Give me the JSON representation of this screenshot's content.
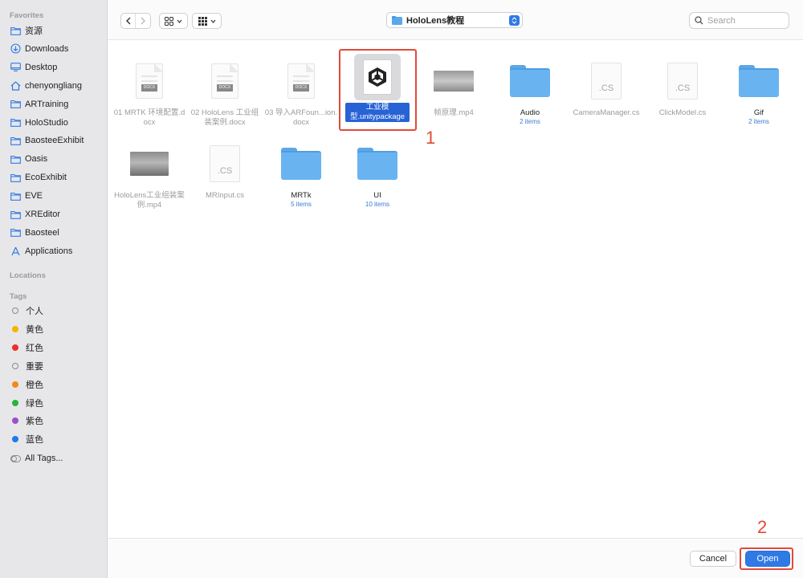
{
  "sidebar": {
    "favorites_label": "Favorites",
    "favorites": [
      {
        "label": "资源",
        "icon": "folder-icon"
      },
      {
        "label": "Downloads",
        "icon": "download-icon"
      },
      {
        "label": "Desktop",
        "icon": "desktop-icon"
      },
      {
        "label": "chenyongliang",
        "icon": "home-icon"
      },
      {
        "label": "ARTraining",
        "icon": "folder-icon"
      },
      {
        "label": "HoloStudio",
        "icon": "folder-icon"
      },
      {
        "label": "BaosteeExhibit",
        "icon": "folder-icon"
      },
      {
        "label": "Oasis",
        "icon": "folder-icon"
      },
      {
        "label": "EcoExhibit",
        "icon": "folder-icon"
      },
      {
        "label": "EVE",
        "icon": "folder-icon"
      },
      {
        "label": "XREditor",
        "icon": "folder-icon"
      },
      {
        "label": "Baosteel",
        "icon": "folder-icon"
      },
      {
        "label": "Applications",
        "icon": "applications-icon"
      }
    ],
    "locations_label": "Locations",
    "tags_label": "Tags",
    "tags": [
      {
        "label": "个人",
        "color": ""
      },
      {
        "label": "黄色",
        "color": "#f5b400"
      },
      {
        "label": "红色",
        "color": "#e8312a"
      },
      {
        "label": "重要",
        "color": ""
      },
      {
        "label": "橙色",
        "color": "#f08a1c"
      },
      {
        "label": "绿色",
        "color": "#27b43c"
      },
      {
        "label": "紫色",
        "color": "#9a4fc9"
      },
      {
        "label": "蓝色",
        "color": "#1f7ae8"
      }
    ],
    "all_tags_label": "All Tags..."
  },
  "toolbar": {
    "location": "HoloLens教程",
    "search_placeholder": "Search"
  },
  "files": [
    {
      "name": "01 MRTK 环境配置.docx",
      "kind": "docx",
      "badge": "DOCX"
    },
    {
      "name": "02 HoloLens 工业组装案例.docx",
      "kind": "docx",
      "badge": "DOCX"
    },
    {
      "name": "03 导入ARFoun...ion.docx",
      "kind": "docx",
      "badge": "DOCX"
    },
    {
      "name": "工业模型.unitypackage",
      "kind": "unitypackage",
      "selected": true
    },
    {
      "name": "帧原理.mp4",
      "kind": "video"
    },
    {
      "name": "Audio",
      "kind": "folder",
      "sub": "2 items"
    },
    {
      "name": "CameraManager.cs",
      "kind": "cs",
      "badge": ".CS"
    },
    {
      "name": "ClickModel.cs",
      "kind": "cs",
      "badge": ".CS"
    },
    {
      "name": "Gif",
      "kind": "folder",
      "sub": "2 items"
    },
    {
      "name": "HoloLens工业组装案例.mp4",
      "kind": "video"
    },
    {
      "name": "MRInput.cs",
      "kind": "cs",
      "badge": ".CS"
    },
    {
      "name": "MRTk",
      "kind": "folder",
      "sub": "5 items"
    },
    {
      "name": "UI",
      "kind": "folder",
      "sub": "10 items"
    }
  ],
  "annotations": {
    "step1": "1",
    "step2": "2"
  },
  "footer": {
    "cancel_label": "Cancel",
    "open_label": "Open"
  }
}
